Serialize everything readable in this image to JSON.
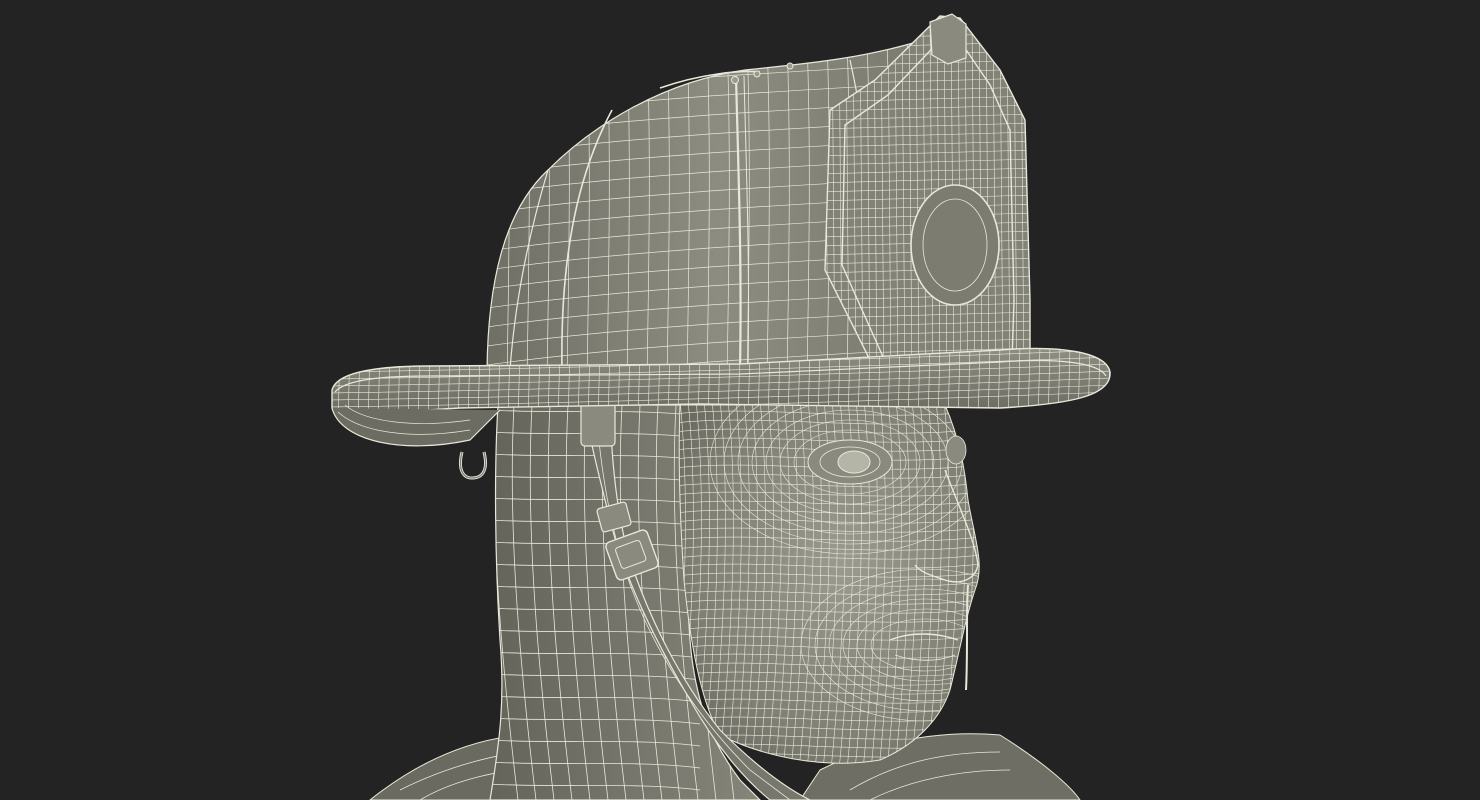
{
  "scene": {
    "background_color": "#232323",
    "surface_color": "#7c7c71",
    "surface_shadow_color": "#5a5a52",
    "surface_light_color": "#9a9a8d",
    "wire_color": "#e8e8da",
    "subject": "wireframe-render-firefighter-head-with-helmet"
  }
}
